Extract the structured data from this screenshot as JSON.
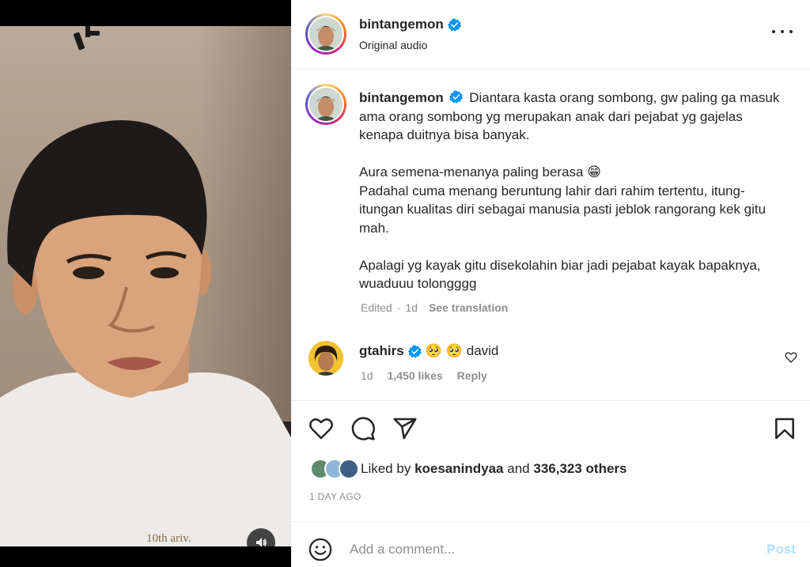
{
  "post": {
    "username": "bintangemon",
    "audio": "Original audio"
  },
  "caption": {
    "username": "bintangemon",
    "paragraphs": [
      "Diantara kasta orang sombong, gw paling ga masuk ama orang sombong yg merupakan anak dari pejabat yg gajelas kenapa duitnya bisa banyak.",
      "Aura semena-menanya paling berasa 😁",
      "Padahal cuma menang beruntung lahir dari rahim tertentu, itung-itungan kualitas diri sebagai manusia pasti jeblok rangorang kek gitu mah.",
      "Apalagi yg kayak gitu disekolahin biar jadi pejabat kayak bapaknya, wuaduuu tolongggg"
    ],
    "edited": "Edited",
    "dot": "·",
    "age": "1d",
    "see_translation": "See translation"
  },
  "comment": {
    "username": "gtahirs",
    "emoji": "🥺 🥺",
    "text": "david",
    "age": "1d",
    "likes": "1,450 likes",
    "reply": "Reply"
  },
  "likes": {
    "prefix": "Liked by",
    "user": "koesanindyaa",
    "and": "and",
    "others": "336,323 others"
  },
  "date": "1 DAY AGO",
  "composer": {
    "placeholder": "Add a comment...",
    "post_label": "Post"
  },
  "colors": {
    "verified": "#0095f6",
    "post_disabled": "#b2dffc",
    "muted_text": "#8e8e8e"
  },
  "icons": {
    "verified": "verified-badge-icon",
    "more": "more-options-icon",
    "like": "heart-icon",
    "comment": "comment-bubble-icon",
    "share": "send-icon",
    "save": "bookmark-icon",
    "emoji": "emoji-smile-icon",
    "audio": "speaker-icon"
  }
}
